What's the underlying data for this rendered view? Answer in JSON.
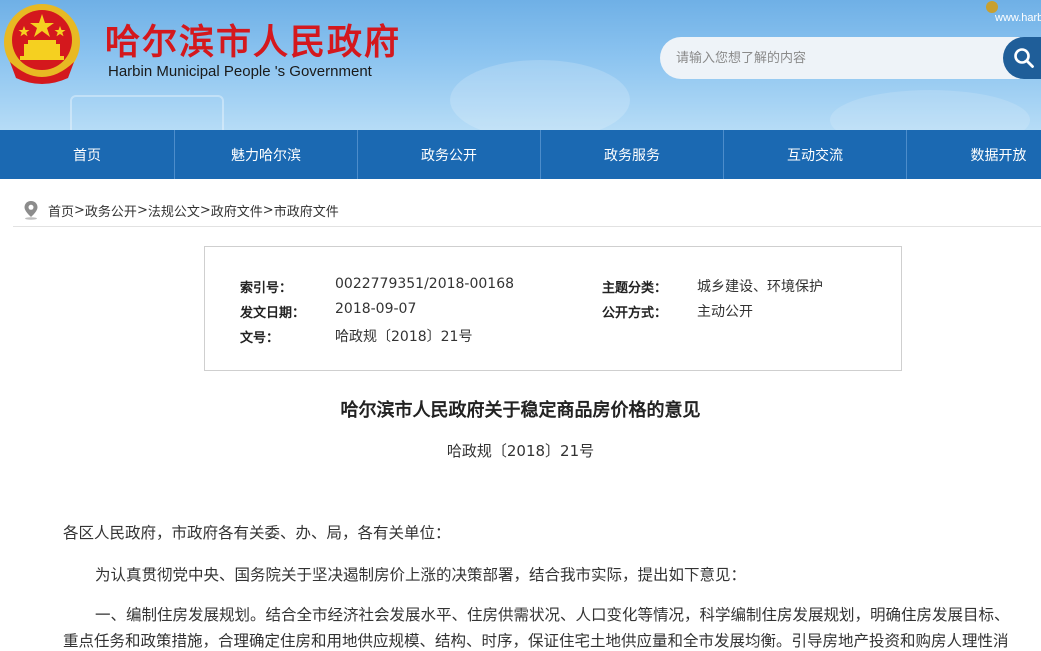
{
  "header": {
    "title_cn": "哈尔滨市人民政府",
    "title_en": "Harbin Municipal People 's Government",
    "corner_text": "www.harb",
    "emblem_icon": "national-emblem-icon",
    "accent": "#d4181d"
  },
  "search": {
    "placeholder": "请输入您想了解的内容",
    "icon": "search-icon"
  },
  "nav": {
    "items": [
      {
        "label": "首页"
      },
      {
        "label": "魅力哈尔滨"
      },
      {
        "label": "政务公开"
      },
      {
        "label": "政务服务"
      },
      {
        "label": "互动交流"
      },
      {
        "label": "数据开放"
      }
    ],
    "background": "#1b69b2"
  },
  "breadcrumb": {
    "icon": "location-pin-icon",
    "items": [
      "首页",
      "政务公开",
      "法规公文",
      "政府文件",
      "市政府文件"
    ],
    "separator": ">"
  },
  "meta": {
    "index_label": "索引号：",
    "index_value": "0022779351/2018-00168",
    "topic_label": "主题分类：",
    "topic_value": "城乡建设、环境保护",
    "date_label": "发文日期：",
    "date_value": "2018-09-07",
    "public_label": "公开方式：",
    "public_value": "主动公开",
    "doc_label": "文号：",
    "doc_value": "哈政规〔2018〕21号"
  },
  "document": {
    "title": "哈尔滨市人民政府关于稳定商品房价格的意见",
    "number": "哈政规〔2018〕21号",
    "paragraphs": [
      "各区人民政府，市政府各有关委、办、局，各有关单位：",
      "为认真贯彻党中央、国务院关于坚决遏制房价上涨的决策部署，结合我市实际，提出如下意见：",
      "一、编制住房发展规划。结合全市经济社会发展水平、住房供需状况、人口变化等情况，科学编制住房发展规划，明确住房发展目标、",
      "重点任务和政策措施，合理确定住房和用地供应规模、结构、时序，保证住宅土地供应量和全市发展均衡。引导房地产投资和购房人理性消"
    ]
  }
}
